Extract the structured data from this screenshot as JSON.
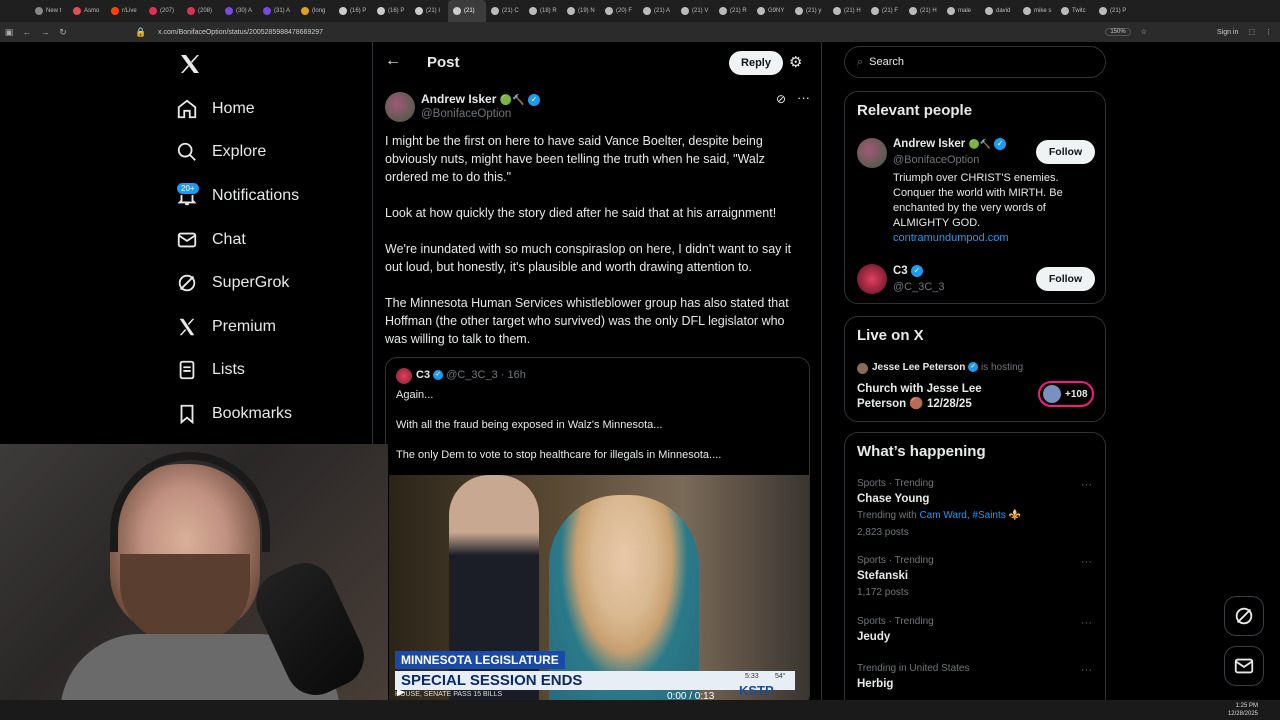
{
  "browser": {
    "tabs": [
      "New t",
      "Asmo",
      "r/Live",
      "(207)",
      "(208)",
      "(30) A",
      "(31) A",
      "(long",
      "(16) P",
      "(16) P",
      "(21) I",
      "(21)",
      "(21) C",
      "(18) R",
      "(19) N",
      "(20) F",
      "(21) A",
      "(21) V",
      "(21) R",
      "G9NY",
      "(21) y",
      "(21) H",
      "(21) F",
      "(21) H",
      "male",
      "david",
      "mike s",
      "Twitc",
      "(21) P"
    ],
    "url": "x.com/BonifaceOption/status/2005285988478669297",
    "zoom": "150%",
    "sign_in": "Sign in"
  },
  "nav": {
    "home": "Home",
    "explore": "Explore",
    "notifications": "Notifications",
    "notifications_badge": "20+",
    "chat": "Chat",
    "supergrok": "SuperGrok",
    "premium": "Premium",
    "lists": "Lists",
    "bookmarks": "Bookmarks"
  },
  "header": {
    "title": "Post",
    "reply": "Reply"
  },
  "post": {
    "author_name": "Andrew Isker",
    "author_emoji": "🟢🔨",
    "handle": "@BonifaceOption",
    "paragraphs": [
      "I might be the first on here to have said Vance Boelter, despite being obviously nuts, might have been telling the truth when he said, \"Walz ordered me to do this.\"",
      "Look at how quickly the story died after he said that at his arraignment!",
      "We're inundated with so much conspiraslop on here, I didn't want to say it out loud, but honestly, it's plausible and worth drawing attention to.",
      "The Minnesota Human Services whistleblower group has also stated that Hoffman (the other target who survived) was the only DFL legislator who was willing to talk to them."
    ]
  },
  "quote": {
    "author": "C3",
    "handle": "@C_3C_3",
    "time": "· 16h",
    "lines": [
      "Again...",
      "With all the fraud being exposed in Walz's Minnesota...",
      "The only Dem to vote to stop healthcare for illegals in Minnesota...."
    ],
    "video": {
      "lower_third_top": "MINNESOTA LEGISLATURE",
      "lower_third_main": "SPECIAL SESSION ENDS",
      "ticker": "HOUSE, SENATE PASS 15 BILLS",
      "clock": "5:33",
      "temp": "54°",
      "station": "KSTP",
      "time_display": "0:00 / 0:13"
    }
  },
  "right": {
    "search_placeholder": "Search",
    "relevant_title": "Relevant people",
    "people": [
      {
        "name": "Andrew Isker",
        "emoji": "🟢🔨",
        "handle": "@BonifaceOption",
        "bio": "Triumph over CHRIST'S enemies. Conquer the world with MIRTH. Be enchanted by the very words of ALMIGHTY GOD.",
        "link": "contramundumpod.com",
        "follow": "Follow"
      },
      {
        "name": "C3",
        "handle": "@C_3C_3",
        "follow": "Follow"
      }
    ],
    "live_title": "Live on X",
    "live": {
      "host": "Jesse Lee Peterson",
      "hosting": "is hosting",
      "title": "Church with Jesse Lee Peterson",
      "date": "12/28/25",
      "count": "+108"
    },
    "happening_title": "What’s happening",
    "trends": [
      {
        "category": "Sports · Trending",
        "name": "Chase Young",
        "with_label": "Trending with",
        "with_links": "Cam Ward, #Saints ⚜️",
        "posts": "2,823 posts"
      },
      {
        "category": "Sports · Trending",
        "name": "Stefanski",
        "posts": "1,172 posts"
      },
      {
        "category": "Sports · Trending",
        "name": "Jeudy"
      },
      {
        "category": "Trending in United States",
        "name": "Herbig"
      }
    ]
  },
  "taskbar": {
    "time": "1:25 PM",
    "date": "12/28/2025"
  },
  "colors": {
    "accent": "#1d9bf0",
    "background": "#000000",
    "border": "#2f3336",
    "muted": "#71767b",
    "live_pink": "#f91880"
  }
}
